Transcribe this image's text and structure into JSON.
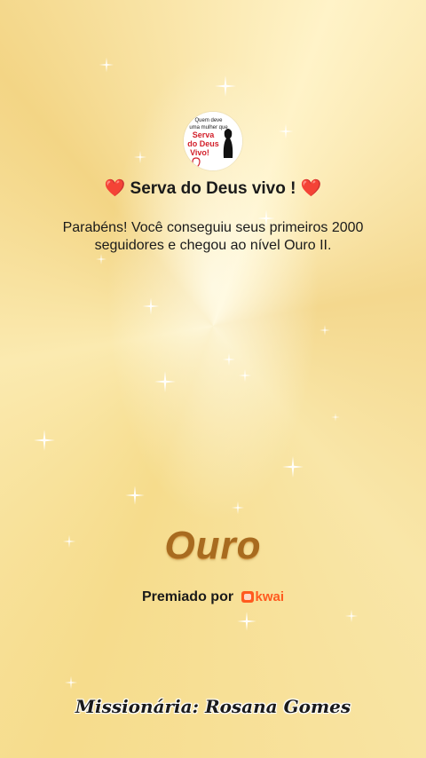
{
  "profile": {
    "avatar_text_line1": "Quem deve",
    "avatar_text_line2": "uma mulher que",
    "avatar_text_line3": "Serva",
    "avatar_text_line4": "do Deus",
    "avatar_text_line5": "Vivo!"
  },
  "header": {
    "heart_left": "❤️",
    "name": "Serva do Deus vivo !",
    "heart_right": "❤️"
  },
  "message": "Parabéns! Você conseguiu seus primeiros 2000 seguidores e chegou ao nível Ouro II.",
  "level": {
    "label": "Ouro"
  },
  "award": {
    "prefix": "Premiado por",
    "brand": "kwai"
  },
  "signature": "Missionária: Rosana Gomes",
  "colors": {
    "accent_gold": "#a86b1f",
    "heart": "#d7262b",
    "kwai": "#ff5a1f"
  },
  "decor": {
    "sparkle_icon": "sparkle-icon"
  }
}
